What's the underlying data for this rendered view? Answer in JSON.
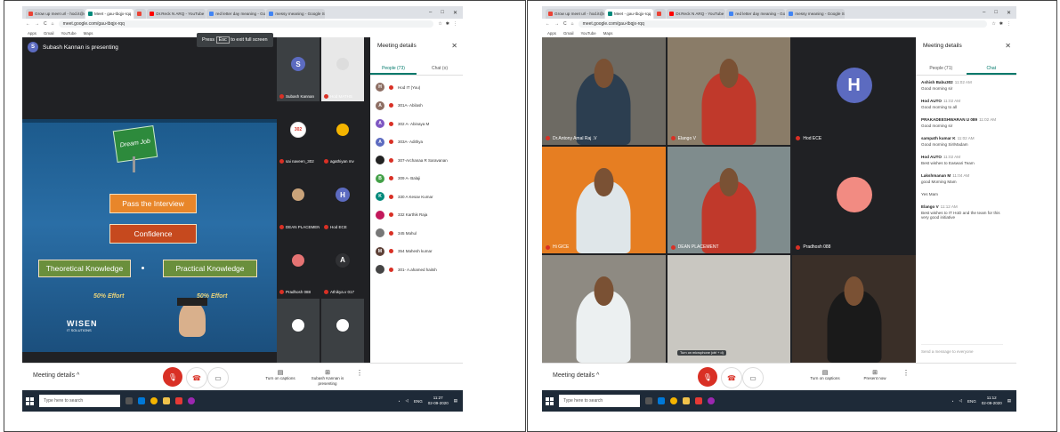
{
  "browser": {
    "tabs": [
      {
        "label": "Grow up meet url - hod.it@ewc",
        "color": "#ea4335"
      },
      {
        "label": "Meet - gau-tbqjx-rqq",
        "color": "#00897b",
        "active": true
      },
      {
        "label": "",
        "color": "#ea4335"
      },
      {
        "label": "Dr.Reck N ARQ - YouTube",
        "color": "#ff0000"
      },
      {
        "label": "red letter day meaning - Google",
        "color": "#4285f4"
      },
      {
        "label": "messy meaning - Google Search",
        "color": "#4285f4"
      }
    ],
    "url": "meet.google.com/gau-tbqjx-rqq",
    "bookmarks": [
      "Apps",
      "Gmail",
      "YouTube",
      "Maps"
    ],
    "fullscreen_hint": {
      "press": "Press",
      "key": "Esc",
      "rest": "to exit full screen"
    }
  },
  "left": {
    "presenter": {
      "initial": "S",
      "text": "Subash Kannan is presenting",
      "color": "#5c6bc0"
    },
    "slide": {
      "sign": "Dream Job",
      "interview": "Pass the Interview",
      "confidence": "Confidence",
      "theory": "Theoretical Knowledge",
      "practical": "Practical Knowledge",
      "effort_left": "50% Effort",
      "effort_right": "50% Effort",
      "logo": "WISEN",
      "logo_sub": "IT SOLUTIONS"
    },
    "tiles": [
      {
        "name": "Subash Kannan",
        "initial": "S",
        "color": "#5c6bc0",
        "bg": "#3c4043"
      },
      {
        "name": "Hod MATHS",
        "initial": "",
        "color": "#ddd",
        "bg": "#e8e8e8"
      },
      {
        "name": "sai naveen_302",
        "initial": "302",
        "color": "#fff",
        "bg": "#202124"
      },
      {
        "name": "agathiyan mv",
        "initial": "",
        "color": "#f4b400",
        "bg": "#202124"
      },
      {
        "name": "DEAN PLACEMENT",
        "initial": "",
        "color": "#c9a37a",
        "bg": "#202124"
      },
      {
        "name": "Hod ECE",
        "initial": "H",
        "color": "#5c6bc0",
        "bg": "#202124"
      },
      {
        "name": "Pradhosh 088",
        "initial": "",
        "color": "#e57373",
        "bg": "#202124"
      },
      {
        "name": "Athikya.v 017",
        "initial": "A",
        "color": "#303134",
        "bg": "#202124"
      },
      {
        "name": "",
        "initial": "",
        "color": "#fff",
        "bg": "#3c4043"
      },
      {
        "name": "",
        "initial": "",
        "color": "#fff",
        "bg": "#3c4043"
      }
    ],
    "panel": {
      "title": "Meeting details",
      "tab_people": "People (73)",
      "tab_chat": "Chat (o)",
      "people": [
        {
          "name": "Hod IT (You)",
          "initial": "H",
          "color": "#8d6e63"
        },
        {
          "name": "301A- Abilash",
          "initial": "A",
          "color": "#8d6e63"
        },
        {
          "name": "302 A- Abinaya M",
          "initial": "A",
          "color": "#7e57c2"
        },
        {
          "name": "303A- Adithya",
          "initial": "A",
          "color": "#5c6bc0"
        },
        {
          "name": "307-Archanaa R Saravanan",
          "initial": "",
          "color": "#222"
        },
        {
          "name": "309 A- Balaji",
          "initial": "B",
          "color": "#43a047"
        },
        {
          "name": "330 A Kesav Kumar",
          "initial": "K",
          "color": "#00897b"
        },
        {
          "name": "332 Karthik Raja",
          "initial": "",
          "color": "#c2185b"
        },
        {
          "name": "345 Mahul",
          "initial": "",
          "color": "#777"
        },
        {
          "name": "354 Mahesh kumar",
          "initial": "M",
          "color": "#5d4037"
        },
        {
          "name": "301- A.ahamed haitsh",
          "initial": "",
          "color": "#444"
        }
      ]
    },
    "controls": {
      "meeting_details": "Meeting details",
      "captions": "Turn on captions",
      "presenting": "Subash Kannan is presenting"
    }
  },
  "right": {
    "tiles": [
      {
        "name": "Dr.Antony Amal Raj .V",
        "bg": "#6d6a63",
        "shirt": "#2c3e50"
      },
      {
        "name": "Elango V",
        "bg": "#8a7c68",
        "shirt": "#c0392b"
      },
      {
        "name": "Hod ECE",
        "bg": "#202124",
        "initial": "H"
      },
      {
        "name": "Hi GICE",
        "bg": "#e67e22",
        "shirt": "#dfe6e9"
      },
      {
        "name": "DEAN PLACEMENT",
        "bg": "#7f8c8d",
        "shirt": "#c0392b"
      },
      {
        "name": "Pradhosh 088",
        "bg": "#202124"
      },
      {
        "name": "",
        "bg": "#8e8a82",
        "shirt": "#ecf0f1"
      },
      {
        "name": "",
        "bg": "#c9c7c1"
      },
      {
        "name": "",
        "bg": "#3a2f28",
        "shirt": "#1a1a1a"
      }
    ],
    "panel": {
      "title": "Meeting details",
      "tab_people": "People (71)",
      "tab_chat": "Chat",
      "messages": [
        {
          "who": "Ashish Babu302",
          "time": "11:02 AM",
          "text": "Good morning sir"
        },
        {
          "who": "Hod AUTO",
          "time": "11:02 AM",
          "text": "Good morning to all"
        },
        {
          "who": "PRAKADEESHWARAN U 089",
          "time": "11:02 AM",
          "text": "Good morning sir"
        },
        {
          "who": "sampath kumar K",
          "time": "11:02 AM",
          "text": "Good morning Sir/Madam"
        },
        {
          "who": "Hod AUTO",
          "time": "11:02 AM",
          "text": "Best wishes to Easwari Team"
        },
        {
          "who": "Lakshmanan M",
          "time": "11:04 AM",
          "text": "good Morning Mam"
        },
        {
          "who": "",
          "time": "",
          "text": "Yes Mam"
        },
        {
          "who": "Elango V",
          "time": "11:12 AM",
          "text": "Best wishes to IT HoD and the team for this very good initiative"
        }
      ],
      "input_placeholder": "Send a message to everyone"
    },
    "controls": {
      "meeting_details": "Meeting details",
      "captions": "Turn on captions",
      "present": "Present now",
      "mic_tooltip": "Turn on microphone (ctrl + d)"
    }
  },
  "taskbar": {
    "search": "Type here to search",
    "lang": "ENG",
    "time_left": "11:27",
    "time_right": "11:12",
    "date": "02-09-2020"
  }
}
